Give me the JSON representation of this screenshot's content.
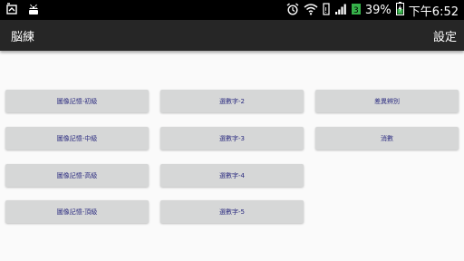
{
  "status_bar": {
    "battery_percent": "39%",
    "time": "下午6:52"
  },
  "action_bar": {
    "title": "脳練",
    "settings_label": "設定"
  },
  "buttons": {
    "col1": [
      "圖像記憶-初級",
      "圖像記憶-中級",
      "圖像記憶-高級",
      "圖像記憶-頂級"
    ],
    "col2": [
      "選數字-2",
      "選數字-3",
      "選數字-4",
      "選數字-5"
    ],
    "col3": [
      "差異辨別",
      "消數"
    ]
  },
  "colors": {
    "status_bar_bg": "#000000",
    "action_bar_bg": "#262626",
    "background": "#fafafa",
    "button_bg": "#d6d7d7",
    "button_text": "#2c2c80"
  }
}
